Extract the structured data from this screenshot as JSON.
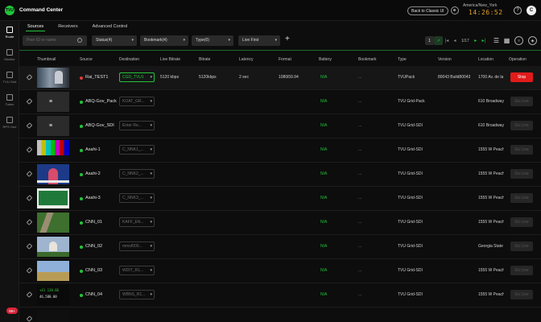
{
  "app": {
    "title": "Command Center",
    "logo_text": "TVU"
  },
  "topbar": {
    "classic_button": "Back to Classic UI",
    "timezone": "America/New_York",
    "clock": "14:26:52",
    "help": "?",
    "avatar": "C",
    "icons": {
      "settings": "gear-icon",
      "help": "help-icon"
    }
  },
  "sidebar": {
    "items": [
      {
        "label": "Route",
        "icon": "route-icon",
        "active": true
      },
      {
        "label": "Monitor",
        "icon": "monitor-icon",
        "active": false
      },
      {
        "label": "TVU Grid",
        "icon": "grid-icon",
        "active": false
      },
      {
        "label": "Token",
        "icon": "token-icon",
        "active": false
      },
      {
        "label": "RPS One",
        "icon": "rps-icon",
        "active": false
      }
    ],
    "badge": "99+"
  },
  "tabs": [
    "Sources",
    "Receivers",
    "Advanced Control"
  ],
  "filters": {
    "search_placeholder": "Peer ID or name",
    "status": "Status(4)",
    "bookmark": "Bookmark(4)",
    "type": "Type(0)",
    "sort": "Live First",
    "add": "+"
  },
  "pager": {
    "page": "1",
    "text": "1/17"
  },
  "columns": [
    "Thumbnail",
    "Source",
    "Destination",
    "Live Bitrate",
    "Bitrate",
    "Latency",
    "Format",
    "Battery",
    "Bookmark",
    "Type",
    "Version",
    "Location",
    "Operation"
  ],
  "rows": [
    {
      "source": "Rai_TEST1",
      "status": "live",
      "dest": "CGD_TVU1",
      "dest_active": true,
      "live_bitrate": "5120 kbps",
      "bitrate": "5120kbps",
      "latency": "2 sec",
      "format": "1080i59.94",
      "battery": "N/A",
      "bookmark": "...",
      "type": "TVUPack",
      "version": "80043 Build80043",
      "location": "1700 Av. de la ...",
      "operation": "Stop",
      "op_active": true,
      "thumb": "studio"
    },
    {
      "source": "ABQ-Gov_Pack",
      "status": "online",
      "dest": "KOAT_GR...",
      "dest_active": false,
      "live_bitrate": "",
      "bitrate": "",
      "latency": "",
      "format": "",
      "battery": "N/A",
      "bookmark": "...",
      "type": "TVU Grid-Pack",
      "version": "",
      "location": "610 Broadway",
      "operation": "Go Live",
      "op_active": false,
      "thumb": "logo"
    },
    {
      "source": "ABQ-Gov_SDI",
      "status": "online",
      "dest": "Enter Re...",
      "dest_active": false,
      "live_bitrate": "",
      "bitrate": "",
      "latency": "",
      "format": "",
      "battery": "N/A",
      "bookmark": "...",
      "type": "TVU Grid-SDI",
      "version": "",
      "location": "610 Broadway",
      "operation": "Go Live",
      "op_active": false,
      "thumb": "logo"
    },
    {
      "source": "Asahi-1",
      "status": "online",
      "dest": "C_NNK1_...",
      "dest_active": false,
      "live_bitrate": "",
      "bitrate": "",
      "latency": "",
      "format": "",
      "battery": "N/A",
      "bookmark": "...",
      "type": "TVU Grid-SDI",
      "version": "",
      "location": "1555 W Peach...",
      "operation": "Go Live",
      "op_active": false,
      "thumb": "bars"
    },
    {
      "source": "Asahi-2",
      "status": "online",
      "dest": "C_NNK2_...",
      "dest_active": false,
      "live_bitrate": "",
      "bitrate": "",
      "latency": "",
      "format": "",
      "battery": "N/A",
      "bookmark": "...",
      "type": "TVU Grid-SDI",
      "version": "",
      "location": "1555 W Peach...",
      "operation": "Go Live",
      "op_active": false,
      "thumb": "anchor"
    },
    {
      "source": "Asahi-3",
      "status": "online",
      "dest": "C_NNK3_...",
      "dest_active": false,
      "live_bitrate": "",
      "bitrate": "",
      "latency": "",
      "format": "",
      "battery": "N/A",
      "bookmark": "...",
      "type": "TVU Grid-SDI",
      "version": "",
      "location": "1555 W Peach...",
      "operation": "Go Live",
      "op_active": false,
      "thumb": "greenbox"
    },
    {
      "source": "CNN_01",
      "status": "online",
      "dest": "KAFF_EN...",
      "dest_active": false,
      "live_bitrate": "",
      "bitrate": "",
      "latency": "",
      "format": "",
      "battery": "N/A",
      "bookmark": "...",
      "type": "TVU Grid-SDI",
      "version": "",
      "location": "1555 W Peach...",
      "operation": "Go Live",
      "op_active": false,
      "thumb": "road"
    },
    {
      "source": "CNN_02",
      "status": "online",
      "dest": "mmsf000...",
      "dest_active": false,
      "live_bitrate": "",
      "bitrate": "",
      "latency": "",
      "format": "",
      "battery": "N/A",
      "bookmark": "...",
      "type": "TVU Grid-SDI",
      "version": "",
      "location": "Georgia State ...",
      "operation": "Go Live",
      "op_active": false,
      "thumb": "capitol"
    },
    {
      "source": "CNN_03",
      "status": "online",
      "dest": "WDIT_R1...",
      "dest_active": false,
      "live_bitrate": "",
      "bitrate": "",
      "latency": "",
      "format": "",
      "battery": "N/A",
      "bookmark": "...",
      "type": "TVU Grid-SDI",
      "version": "",
      "location": "1555 W Peach...",
      "operation": "Go Live",
      "op_active": false,
      "thumb": "field"
    },
    {
      "source": "CNN_04",
      "status": "online",
      "dest": "WBNS_R1...",
      "dest_active": false,
      "live_bitrate": "",
      "bitrate": "",
      "latency": "",
      "format": "",
      "battery": "N/A",
      "bookmark": "...",
      "type": "TVU Grid-SDI",
      "version": "",
      "location": "1555 W Peach...",
      "operation": "Go Live",
      "op_active": false,
      "thumb": "stocks"
    },
    {
      "source": "",
      "status": "",
      "dest": "",
      "dest_active": false,
      "live_bitrate": "",
      "bitrate": "",
      "latency": "",
      "format": "",
      "battery": "",
      "bookmark": "",
      "type": "",
      "version": "",
      "location": "",
      "operation": "",
      "op_active": false,
      "thumb": "blank"
    }
  ],
  "colors": {
    "accent": "#22c53a",
    "live": "#e03a3a",
    "stop": "#e01b1b",
    "clock": "#e3a326",
    "bg": "#0d0d0d"
  }
}
